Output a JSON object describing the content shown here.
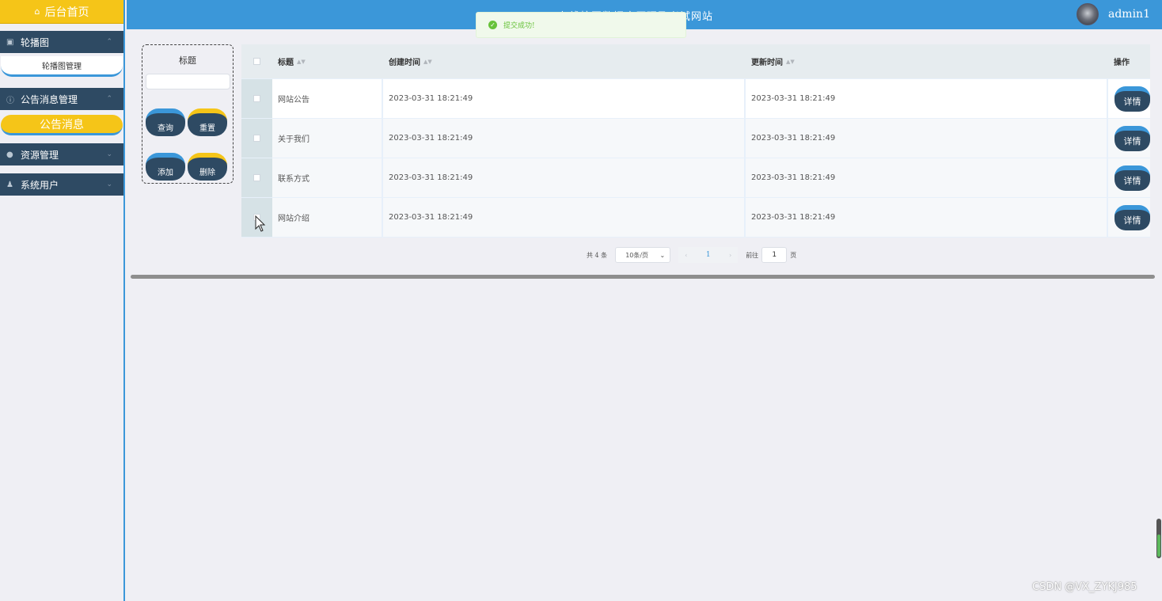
{
  "sidebar": {
    "home": "后台首页",
    "sections": [
      {
        "label": "轮播图",
        "icon": "image-icon",
        "expanded": true,
        "items": [
          "轮播图管理"
        ]
      },
      {
        "label": "公告消息管理",
        "icon": "info-icon",
        "expanded": true,
        "items": [
          "公告消息"
        ]
      },
      {
        "label": "资源管理",
        "icon": "location-icon",
        "expanded": false,
        "items": []
      },
      {
        "label": "系统用户",
        "icon": "user-icon",
        "expanded": false,
        "items": []
      }
    ]
  },
  "header": {
    "title": "在线校园数据库原理及考试网站",
    "username": "admin1"
  },
  "toast": {
    "message": "提交成功!"
  },
  "search": {
    "label": "标题",
    "input_value": "",
    "query_label": "查询",
    "reset_label": "重置",
    "add_label": "添加",
    "delete_label": "删除"
  },
  "table": {
    "columns": [
      "标题",
      "创建时间",
      "更新时间",
      "操作"
    ],
    "rows": [
      {
        "title": "网站公告",
        "created": "2023-03-31 18:21:49",
        "updated": "2023-03-31 18:21:49",
        "action": "详情"
      },
      {
        "title": "关于我们",
        "created": "2023-03-31 18:21:49",
        "updated": "2023-03-31 18:21:49",
        "action": "详情"
      },
      {
        "title": "联系方式",
        "created": "2023-03-31 18:21:49",
        "updated": "2023-03-31 18:21:49",
        "action": "详情"
      },
      {
        "title": "网站介绍",
        "created": "2023-03-31 18:21:49",
        "updated": "2023-03-31 18:21:49",
        "action": "详情"
      }
    ]
  },
  "pagination": {
    "total_text": "共 4 条",
    "page_size": "10条/页",
    "current_page": "1",
    "goto_prefix": "前往",
    "goto_value": "1",
    "goto_suffix": "页"
  },
  "watermark": "CSDN @VX_ZYKJ985",
  "colors": {
    "accent_blue": "#3b97d9",
    "accent_yellow": "#f5c518",
    "dark_navy": "#2e4a63",
    "success_green": "#67c23a"
  }
}
